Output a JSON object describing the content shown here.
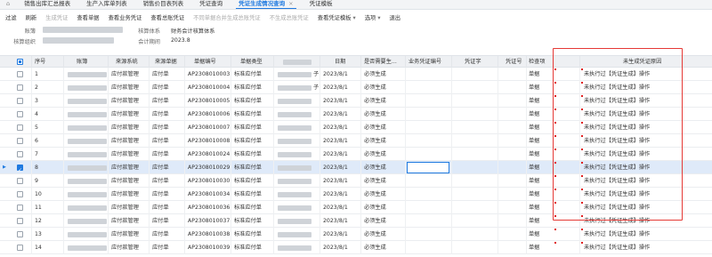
{
  "tabs": [
    {
      "label": "",
      "icon": "home-icon"
    },
    {
      "label": "销售出库汇总报表"
    },
    {
      "label": "生产入库单列表"
    },
    {
      "label": "销售价目表列表"
    },
    {
      "label": "凭证查询"
    },
    {
      "label": "凭证生成情况查询",
      "active": true
    },
    {
      "label": "凭证模板"
    }
  ],
  "toolbar": {
    "filter": "过滤",
    "refresh": "刷新",
    "gen_voucher": "生成凭证",
    "view_doc": "查看单据",
    "view_biz_voucher": "查看业务凭证",
    "view_gl_voucher": "查看总账凭证",
    "no_merge": "不同单据合并生成总账凭证",
    "no_gen": "不生成总账凭证",
    "view_template": "查看凭证模板",
    "options": "选项",
    "exit": "退出"
  },
  "form": {
    "account_book_label": "账簿",
    "accounting_org_label": "核算组织",
    "accounting_system_label": "核算体系",
    "accounting_system_value": "财务会计核算体系",
    "accounting_period_label": "会计期间",
    "accounting_period_value": "2023.8"
  },
  "columns": [
    "",
    "序号",
    "账簿",
    "来源系统",
    "来源单据",
    "单据编号",
    "单据类型",
    "",
    "日期",
    "是否需要生...",
    "业务凭证编号",
    "凭证字",
    "凭证号",
    "检查项",
    "未生成凭证原因"
  ],
  "rows": [
    {
      "seq": "1",
      "system": "应付款管理",
      "source": "应付单",
      "number": "AP2308010003",
      "type": "标准应付单",
      "suffix": "子",
      "date": "2023/8/1",
      "need": "必须生成",
      "check": "单据",
      "reason": "未执行过【凭证生成】操作"
    },
    {
      "seq": "2",
      "system": "应付款管理",
      "source": "应付单",
      "number": "AP2308010004",
      "type": "标准应付单",
      "suffix": "子",
      "date": "2023/8/1",
      "need": "必须生成",
      "check": "单据",
      "reason": "未执行过【凭证生成】操作"
    },
    {
      "seq": "3",
      "system": "应付款管理",
      "source": "应付单",
      "number": "AP2308010005",
      "type": "标准应付单",
      "suffix": "",
      "date": "2023/8/1",
      "need": "必须生成",
      "check": "单据",
      "reason": "未执行过【凭证生成】操作"
    },
    {
      "seq": "4",
      "system": "应付款管理",
      "source": "应付单",
      "number": "AP2308010006",
      "type": "标准应付单",
      "suffix": "",
      "date": "2023/8/1",
      "need": "必须生成",
      "check": "单据",
      "reason": "未执行过【凭证生成】操作"
    },
    {
      "seq": "5",
      "system": "应付款管理",
      "source": "应付单",
      "number": "AP2308010007",
      "type": "标准应付单",
      "suffix": "",
      "date": "2023/8/1",
      "need": "必须生成",
      "check": "单据",
      "reason": "未执行过【凭证生成】操作"
    },
    {
      "seq": "6",
      "system": "应付款管理",
      "source": "应付单",
      "number": "AP2308010008",
      "type": "标准应付单",
      "suffix": "",
      "date": "2023/8/1",
      "need": "必须生成",
      "check": "单据",
      "reason": "未执行过【凭证生成】操作"
    },
    {
      "seq": "7",
      "system": "应付款管理",
      "source": "应付单",
      "number": "AP2308010024",
      "type": "标准应付单",
      "suffix": "",
      "date": "2023/8/1",
      "need": "必须生成",
      "check": "单据",
      "reason": "未执行过【凭证生成】操作"
    },
    {
      "seq": "8",
      "system": "应付款管理",
      "source": "应付单",
      "number": "AP2308010029",
      "type": "标准应付单",
      "suffix": "",
      "date": "2023/8/1",
      "need": "必须生成",
      "check": "单据",
      "reason": "未执行过【凭证生成】操作",
      "selected": true
    },
    {
      "seq": "9",
      "system": "应付款管理",
      "source": "应付单",
      "number": "AP2308010030",
      "type": "标准应付单",
      "suffix": "",
      "date": "2023/8/1",
      "need": "必须生成",
      "check": "单据",
      "reason": "未执行过【凭证生成】操作"
    },
    {
      "seq": "10",
      "system": "应付款管理",
      "source": "应付单",
      "number": "AP2308010034",
      "type": "标准应付单",
      "suffix": "",
      "date": "2023/8/1",
      "need": "必须生成",
      "check": "单据",
      "reason": "未执行过【凭证生成】操作"
    },
    {
      "seq": "11",
      "system": "应付款管理",
      "source": "应付单",
      "number": "AP2308010036",
      "type": "标准应付单",
      "suffix": "",
      "date": "2023/8/1",
      "need": "必须生成",
      "check": "单据",
      "reason": "未执行过【凭证生成】操作"
    },
    {
      "seq": "12",
      "system": "应付款管理",
      "source": "应付单",
      "number": "AP2308010037",
      "type": "标准应付单",
      "suffix": "",
      "date": "2023/8/1",
      "need": "必须生成",
      "check": "单据",
      "reason": "未执行过【凭证生成】操作"
    },
    {
      "seq": "13",
      "system": "应付款管理",
      "source": "应付单",
      "number": "AP2308010038",
      "type": "标准应付单",
      "suffix": "",
      "date": "2023/8/1",
      "need": "必须生成",
      "check": "单据",
      "reason": "未执行过【凭证生成】操作"
    },
    {
      "seq": "14",
      "system": "应付款管理",
      "source": "应付单",
      "number": "AP2308010039",
      "type": "标准应付单",
      "suffix": "",
      "date": "2023/8/1",
      "need": "必须生成",
      "check": "单据",
      "reason": "未执行过【凭证生成】操作"
    }
  ],
  "colors": {
    "accent": "#1f7ae0",
    "highlight": "#e53935"
  }
}
